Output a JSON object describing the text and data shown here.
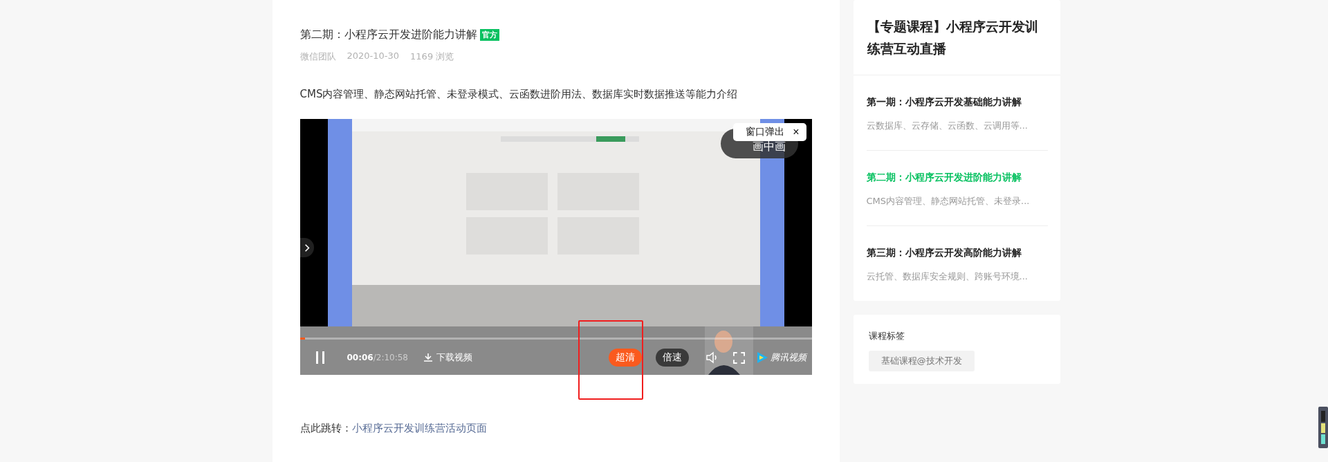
{
  "article": {
    "title": "第二期：小程序云开发进阶能力讲解",
    "badge": "官方",
    "author": "微信团队",
    "date": "2020-10-30",
    "views": "1169 浏览",
    "description": "CMS内容管理、静态网站托管、未登录模式、云函数进阶用法、数据库实时数据推送等能力介绍"
  },
  "player": {
    "kind": "picture",
    "pip": "画中画",
    "popup": {
      "label": "窗口弹出",
      "close": "×"
    },
    "progress": {
      "level": 0.01
    },
    "time_current": "00:06",
    "time_total": "/2:10:58",
    "download": "下载视频",
    "quality": "超清",
    "speed": "倍速",
    "brand": "腾讯视频"
  },
  "jump": {
    "label": "点此跳转：",
    "link": "小程序云开发训练营活动页面"
  },
  "sidebar": {
    "title": "【专题课程】小程序云开发训练营互动直播",
    "episodes": [
      {
        "title": "第一期：小程序云开发基础能力讲解",
        "summary": "云数据库、云存储、云函数、云调用等...",
        "selected": false
      },
      {
        "title": "第二期：小程序云开发进阶能力讲解",
        "summary": "CMS内容管理、静态网站托管、未登录...",
        "selected": true
      },
      {
        "title": "第三期：小程序云开发高阶能力讲解",
        "summary": "云托管、数据库安全规则、跨账号环境...",
        "selected": false
      }
    ],
    "tags_title": "课程标签",
    "tags": [
      "基础课程@技术开发"
    ]
  }
}
